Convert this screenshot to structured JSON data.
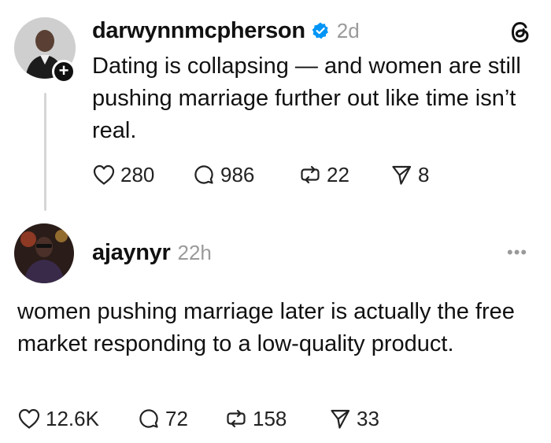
{
  "posts": [
    {
      "username": "darwynnmcpherson",
      "verified": true,
      "time": "2d",
      "text": "Dating is collapsing — and women are still pushing marriage further out like time isn’t real.",
      "actions": {
        "likes": "280",
        "replies": "986",
        "reposts": "22",
        "shares": "8"
      }
    },
    {
      "username": "ajaynyr",
      "time": "22h",
      "text": "women pushing marriage later is actually the free market responding to a low-quality product.",
      "actions": {
        "likes": "12.6K",
        "replies": "72",
        "reposts": "158",
        "shares": "33"
      }
    }
  ],
  "colors": {
    "verified_badge": "#0095f6",
    "secondary_text": "#9a9a9a",
    "thread_line": "#d6d6d6"
  },
  "icons": {
    "follow": "plus-icon",
    "app": "threads-logo-icon",
    "more": "more-horizontal-icon",
    "like": "heart-icon",
    "reply": "comment-icon",
    "repost": "repost-icon",
    "share": "send-icon"
  }
}
